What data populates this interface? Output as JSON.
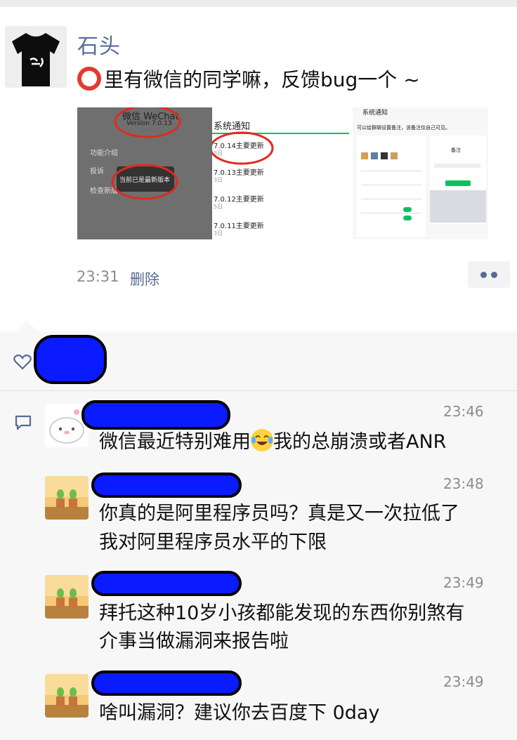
{
  "post": {
    "author": "石头",
    "text": "里有微信的同学嘛，反馈bug一个 ~",
    "time": "23:31",
    "delete_label": "删除",
    "images": [
      {
        "title": "微信 WeChat",
        "version": "Version 7.0.13",
        "menu": [
          "功能介绍",
          "投诉",
          "检查新版"
        ],
        "toast": "当前已是最新版本"
      },
      {
        "header": "系统通知",
        "items": [
          {
            "title": "7.0.14主要更新",
            "date": "3日"
          },
          {
            "title": "7.0.13主要更新",
            "date": "3日"
          },
          {
            "title": "7.0.12主要更新",
            "date": "5日"
          },
          {
            "title": "7.0.11主要更新",
            "date": "3日"
          }
        ]
      },
      {
        "header": "系统通知",
        "subtitle": "可以给群聊设置备注，该备注仅自己可见。",
        "dialog_title": "备注"
      }
    ]
  },
  "comments": [
    {
      "time": "23:46",
      "text_before_emoji": "微信最近特别难用",
      "text_after_emoji": "我的总崩溃或者ANR"
    },
    {
      "time": "23:48",
      "line1": "你真的是阿里程序员吗？真是又一次拉低了",
      "line2": "我对阿里程序员水平的下限"
    },
    {
      "time": "23:49",
      "line1": "拜托这种10岁小孩都能发现的东西你别煞有",
      "line2": "介事当做漏洞来报告啦"
    },
    {
      "time": "23:49",
      "line1": "啥叫漏洞？建议你去百度下  0day"
    }
  ],
  "colors": {
    "link": "#576b95",
    "meta": "#8c8c8c",
    "redaction": "#0b1bff",
    "ring": "#e23b2e"
  }
}
